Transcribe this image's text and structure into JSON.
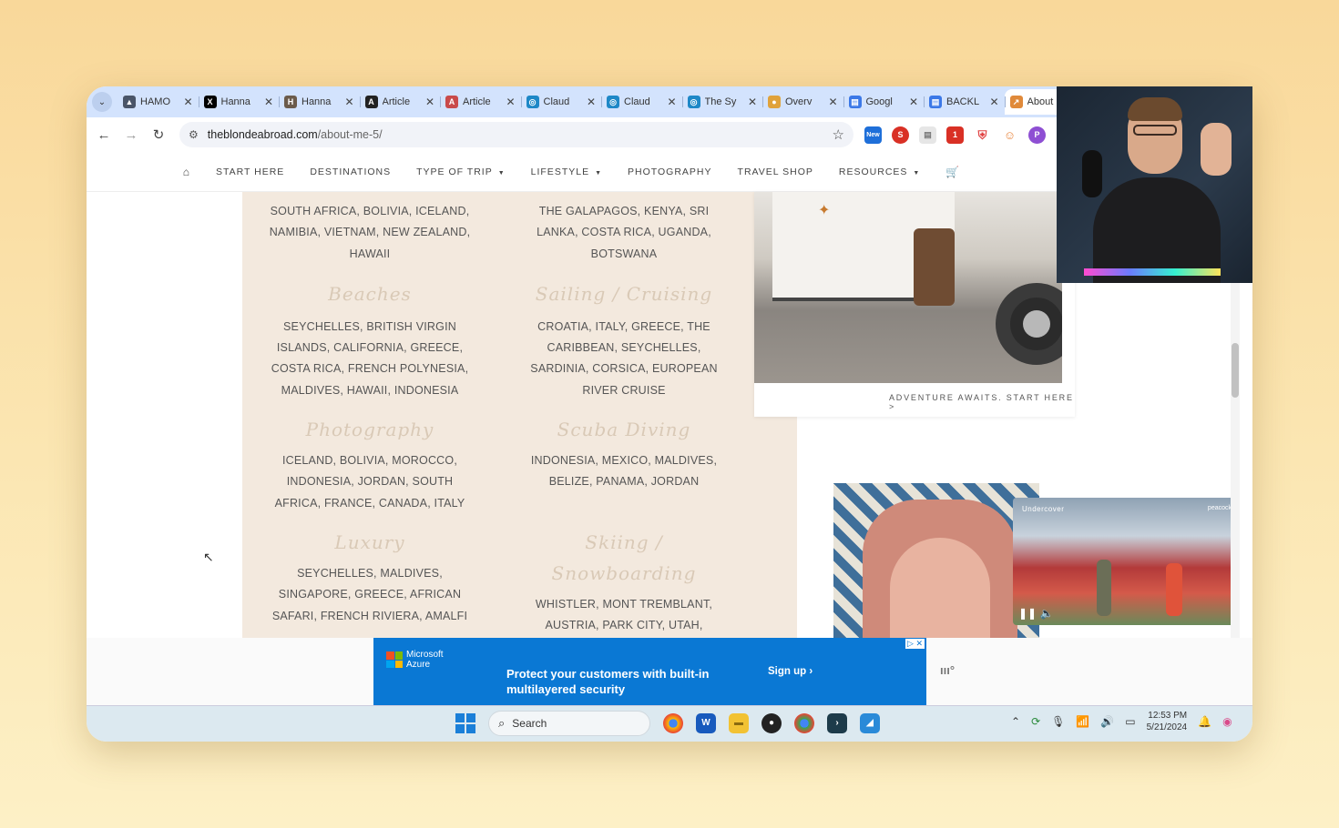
{
  "browser": {
    "tabs": [
      {
        "label": "HAMO",
        "fav_color": "#4a5568",
        "fav_glyph": "▲"
      },
      {
        "label": "Hanna",
        "fav_color": "#000000",
        "fav_glyph": "X"
      },
      {
        "label": "Hanna",
        "fav_color": "#6b5b4b",
        "fav_glyph": "H"
      },
      {
        "label": "Article",
        "fav_color": "#222222",
        "fav_glyph": "A"
      },
      {
        "label": "Article",
        "fav_color": "#c94a4a",
        "fav_glyph": "A"
      },
      {
        "label": "Claud",
        "fav_color": "#1e88c7",
        "fav_glyph": "◎"
      },
      {
        "label": "Claud",
        "fav_color": "#1e88c7",
        "fav_glyph": "◎"
      },
      {
        "label": "The Sy",
        "fav_color": "#1e88c7",
        "fav_glyph": "◎"
      },
      {
        "label": "Overv",
        "fav_color": "#e0a23a",
        "fav_glyph": "●"
      },
      {
        "label": "Googl",
        "fav_color": "#3b78e7",
        "fav_glyph": "▤"
      },
      {
        "label": "BACKL",
        "fav_color": "#3b78e7",
        "fav_glyph": "▤"
      },
      {
        "label": "About",
        "fav_color": "#e08a3a",
        "fav_glyph": "↗"
      }
    ],
    "url_domain": "theblondeabroad.com",
    "url_path": "/about-me-5/"
  },
  "site_nav": {
    "items": [
      "START HERE",
      "DESTINATIONS",
      "TYPE OF TRIP",
      "LIFESTYLE",
      "PHOTOGRAPHY",
      "TRAVEL SHOP",
      "RESOURCES"
    ]
  },
  "content": {
    "left_col": {
      "top_text": "SOUTH AFRICA, BOLIVIA, ICELAND, NAMIBIA, VIETNAM, NEW ZEALAND, HAWAII",
      "s1_title": "Beaches",
      "s1_text": "SEYCHELLES, BRITISH VIRGIN ISLANDS, CALIFORNIA, GREECE, COSTA RICA, FRENCH POLYNESIA, MALDIVES, HAWAII, INDONESIA",
      "s2_title": "Photography",
      "s2_text": "ICELAND, BOLIVIA, MOROCCO, INDONESIA, JORDAN, SOUTH AFRICA, FRANCE, CANADA, ITALY",
      "s3_title": "Luxury",
      "s3_text": "SEYCHELLES, MALDIVES, SINGAPORE, GREECE, AFRICAN SAFARI, FRENCH RIVIERA, AMALFI"
    },
    "right_col": {
      "top_text": "THE GALAPAGOS, KENYA, SRI LANKA, COSTA RICA, UGANDA, BOTSWANA",
      "s1_title": "Sailing / Cruising",
      "s1_text": "CROATIA, ITALY, GREECE, THE CARIBBEAN, SEYCHELLES, SARDINIA, CORSICA, EUROPEAN RIVER CRUISE",
      "s2_title": "Scuba Diving",
      "s2_text": "INDONESIA, MEXICO, MALDIVES, BELIZE, PANAMA, JORDAN",
      "s3_title": "Skiing / Snowboarding",
      "s3_text": "WHISTLER, MONT TREMBLANT, AUSTRIA, PARK CITY, UTAH, SWITZERLAND"
    },
    "image_caption": "ADVENTURE AWAITS. START HERE >"
  },
  "video": {
    "brand": "Undercover",
    "network": "peacock"
  },
  "ad": {
    "brand_line1": "Microsoft",
    "brand_line2": "Azure",
    "headline": "Protect your customers with built-in multilayered security",
    "cta": "Sign up ›"
  },
  "taskbar": {
    "search_placeholder": "Search",
    "time": "12:53 PM",
    "date": "5/21/2024"
  }
}
